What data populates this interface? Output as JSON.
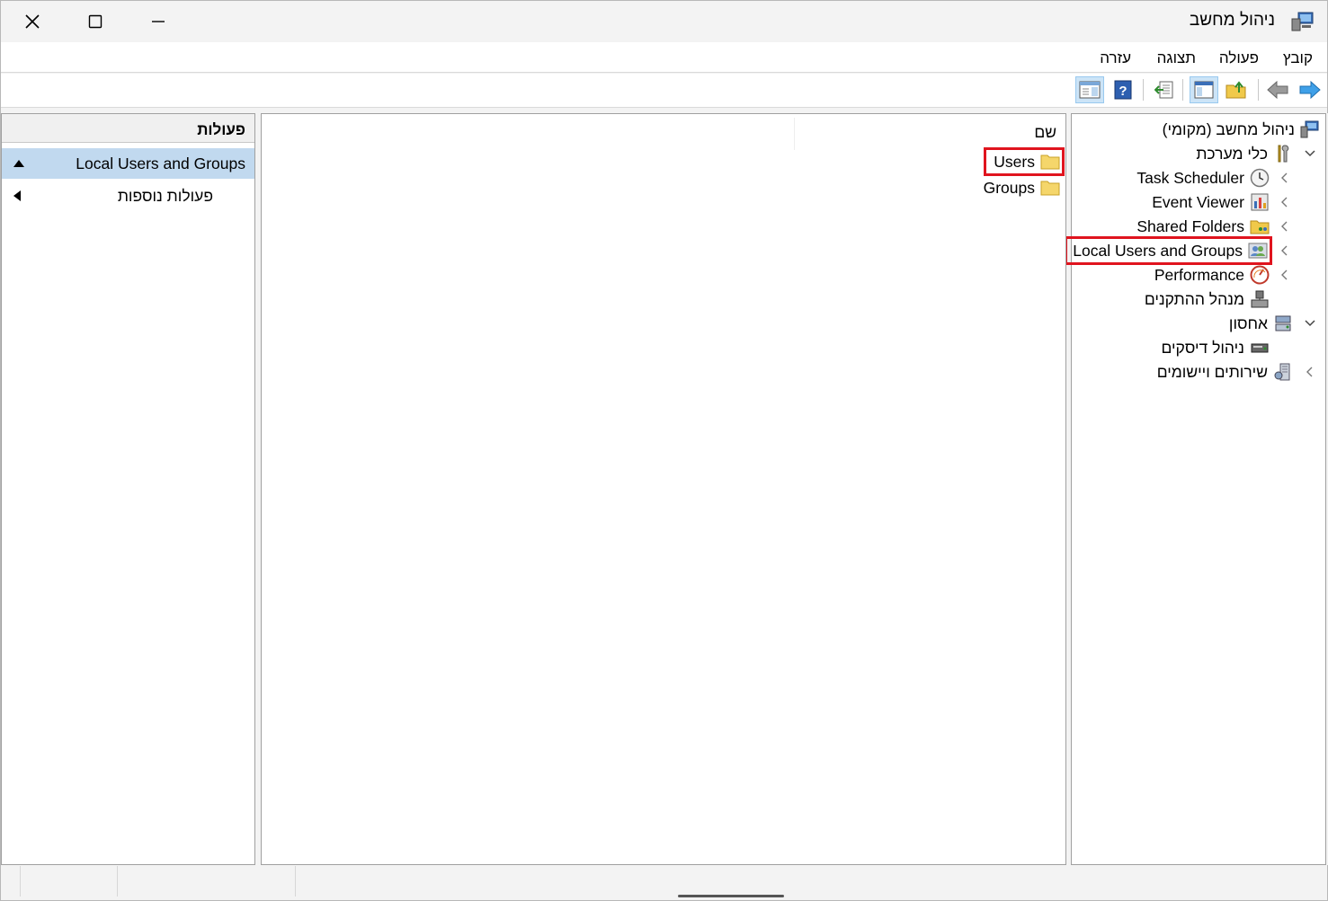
{
  "window": {
    "title": "ניהול מחשב",
    "controls": {
      "close": "close",
      "maximize": "maximize",
      "minimize": "minimize"
    }
  },
  "menu": [
    "קובץ",
    "פעולה",
    "תצוגה",
    "עזרה"
  ],
  "toolbar": {
    "buttons": [
      "forward-icon",
      "back-icon",
      "up-folder-icon",
      "show-hide-tree-icon",
      "export-list-icon",
      "help-icon",
      "properties-icon"
    ]
  },
  "tree": {
    "root": "ניהול מחשב (מקומי)",
    "system_tools": "כלי מערכת",
    "task_scheduler": "Task Scheduler",
    "event_viewer": "Event Viewer",
    "shared_folders": "Shared Folders",
    "local_users_groups": "Local Users and Groups",
    "performance": "Performance",
    "device_manager": "מנהל ההתקנים",
    "storage": "אחסון",
    "disk_management": "ניהול דיסקים",
    "services_apps": "שירותים ויישומים"
  },
  "content": {
    "column_name": "שם",
    "items": [
      "Users",
      "Groups"
    ]
  },
  "actions": {
    "header": "פעולות",
    "section": "Local Users and Groups",
    "more": "פעולות נוספות"
  },
  "colors": {
    "highlight_box": "#e0141e",
    "selected_row": "#c1d9ef",
    "folder": "#f5d66b"
  }
}
